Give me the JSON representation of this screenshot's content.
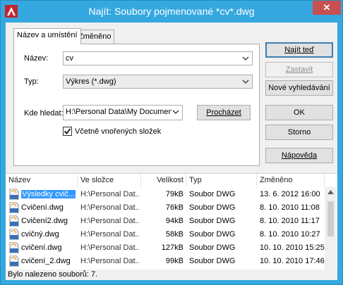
{
  "window": {
    "title": "Najít: Soubory pojmenované *cv*.dwg",
    "close_label": "✕"
  },
  "tabs": [
    {
      "label": "Název a umístění",
      "active": true
    },
    {
      "label": "Změněno",
      "active": false
    }
  ],
  "form": {
    "name_label": "Název:",
    "name_value": "cv",
    "type_label": "Typ:",
    "type_value": "Výkres (*.dwg)",
    "lookin_label": "Kde hledat:",
    "lookin_value": "H:\\Personal Data\\My Documents",
    "browse_label": "Procházet",
    "subfolders_label": "Včetně vnořených složek",
    "subfolders_checked": true
  },
  "buttons": {
    "find_now": "Najít teď",
    "stop": "Zastavit",
    "new_search": "Nové vyhledávání",
    "ok": "OK",
    "cancel": "Storno",
    "help": "Nápověda"
  },
  "results": {
    "columns": [
      "Název",
      "Ve složce",
      "Velikost",
      "Typ",
      "Změněno"
    ],
    "rows": [
      {
        "name": "Výsledky cvič...",
        "folder": "H:\\Personal Dat...",
        "size": "79kB",
        "type": "Soubor DWG",
        "modified": "13. 6. 2012 16:00",
        "selected": true
      },
      {
        "name": "Cvičení.dwg",
        "folder": "H:\\Personal Dat...",
        "size": "76kB",
        "type": "Soubor DWG",
        "modified": "8. 10. 2010 11:08",
        "selected": false
      },
      {
        "name": "Cvičení2.dwg",
        "folder": "H:\\Personal Dat...",
        "size": "94kB",
        "type": "Soubor DWG",
        "modified": "8. 10. 2010 11:17",
        "selected": false
      },
      {
        "name": "cvičný.dwg",
        "folder": "H:\\Personal Dat...",
        "size": "58kB",
        "type": "Soubor DWG",
        "modified": "8. 10. 2010 10:27",
        "selected": false
      },
      {
        "name": "cvičení.dwg",
        "folder": "H:\\Personal Dat...",
        "size": "127kB",
        "type": "Soubor DWG",
        "modified": "10. 10. 2010 15:25",
        "selected": false
      },
      {
        "name": "cvičení_2.dwg",
        "folder": "H:\\Personal Dat...",
        "size": "99kB",
        "type": "Soubor DWG",
        "modified": "10. 10. 2010 17:46",
        "selected": false
      }
    ]
  },
  "status": "Bylo nalezeno souborů: 7.",
  "colors": {
    "titlebar": "#35a8e0",
    "close": "#c75050",
    "selection": "#3399ff"
  }
}
